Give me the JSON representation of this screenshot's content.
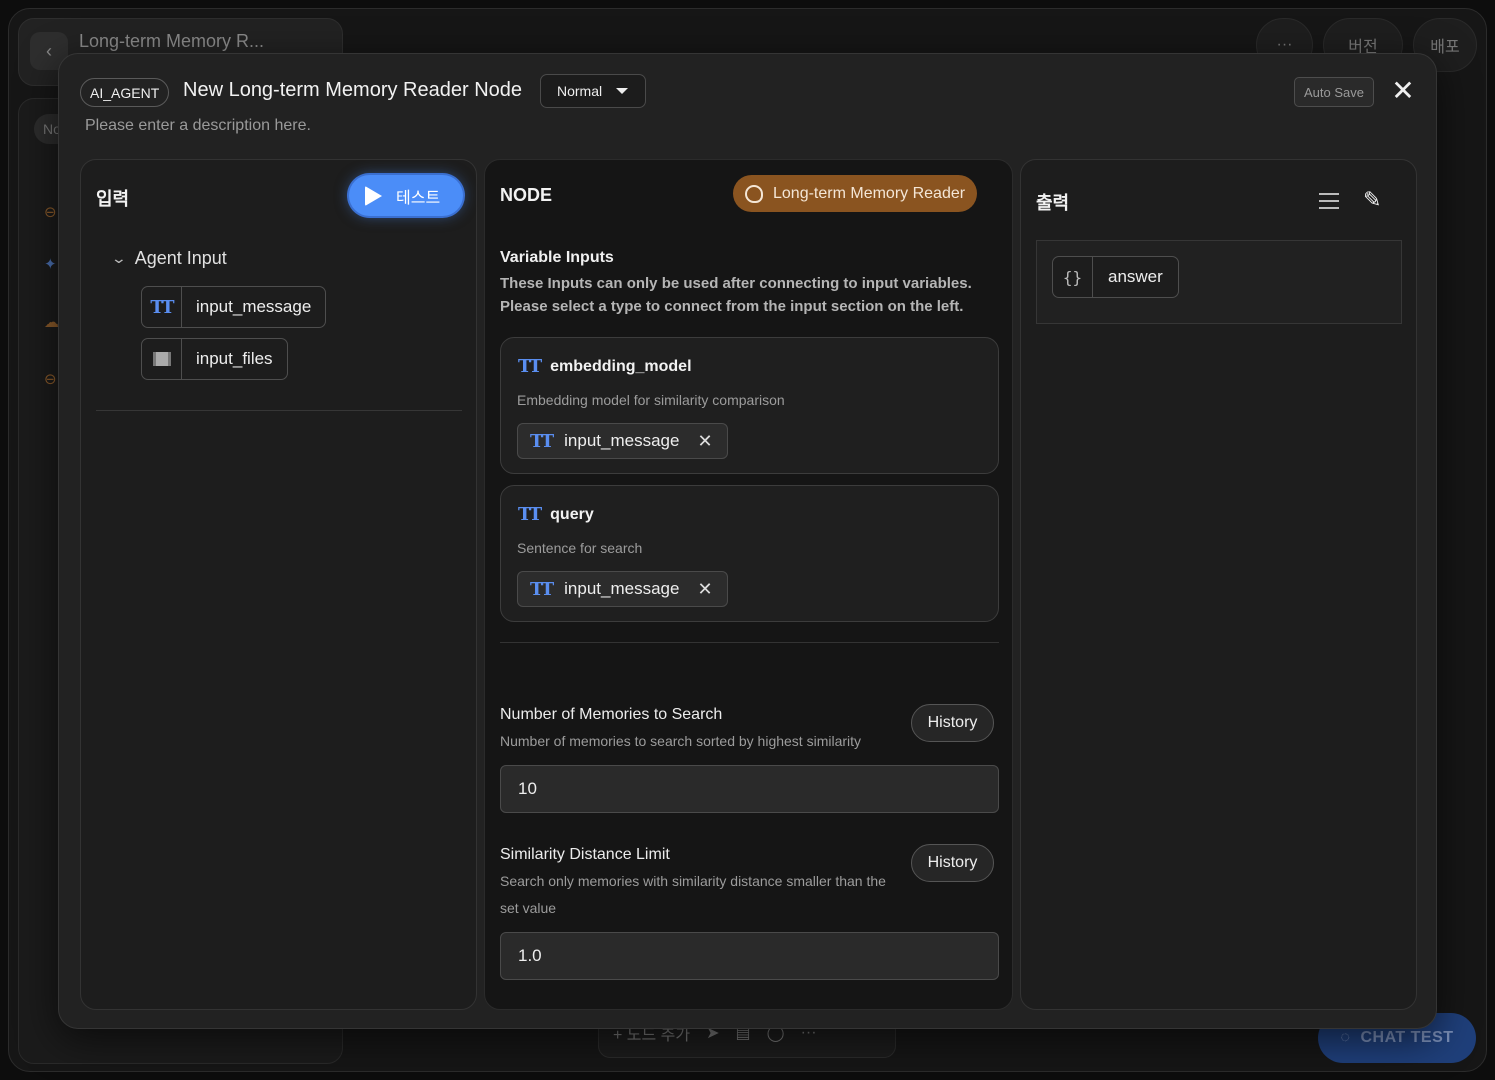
{
  "background": {
    "workflow_title": "Long-term Memory R...",
    "sidebar_tag": "No",
    "more_label": "···",
    "version_label": "버전",
    "deploy_label": "배포",
    "add_node_label": "+ 노드 추가",
    "chat_test_label": "CHAT TEST"
  },
  "modal": {
    "type_chip": "AI_AGENT",
    "title": "New Long-term Memory Reader Node",
    "mode": "Normal",
    "description_placeholder": "Please enter a description here.",
    "auto_save": "Auto Save",
    "close_glyph": "✕"
  },
  "input_panel": {
    "title": "입력",
    "test_label": "테스트",
    "group_label": "Agent Input",
    "variables": [
      {
        "name": "input_message",
        "type": "text"
      },
      {
        "name": "input_files",
        "type": "file"
      }
    ]
  },
  "node_panel": {
    "title": "NODE",
    "type_badge": "Long-term Memory Reader",
    "variable_inputs_title": "Variable Inputs",
    "variable_inputs_note_1": "These Inputs can only be used after connecting to input variables.",
    "variable_inputs_note_2": "Please select a type to connect from the input section on the left.",
    "inputs": [
      {
        "name": "embedding_model",
        "description": "Embedding model for similarity comparison",
        "connected": "input_message"
      },
      {
        "name": "query",
        "description": "Sentence for search",
        "connected": "input_message"
      }
    ],
    "fields": [
      {
        "label": "Number of Memories to Search",
        "help": "Number of memories to search sorted by highest similarity",
        "history": "History",
        "value": "10"
      },
      {
        "label": "Similarity Distance Limit",
        "help": "Search only memories with similarity distance smaller than the set value",
        "history": "History",
        "value": "1.0"
      }
    ]
  },
  "output_panel": {
    "title": "출력",
    "outputs": [
      {
        "name": "answer",
        "icon": "braces-icon"
      }
    ]
  },
  "colors": {
    "accent_blue": "#4b8df8",
    "badge_brown": "#8a5420",
    "text_icon_blue": "#5a8ef0"
  }
}
